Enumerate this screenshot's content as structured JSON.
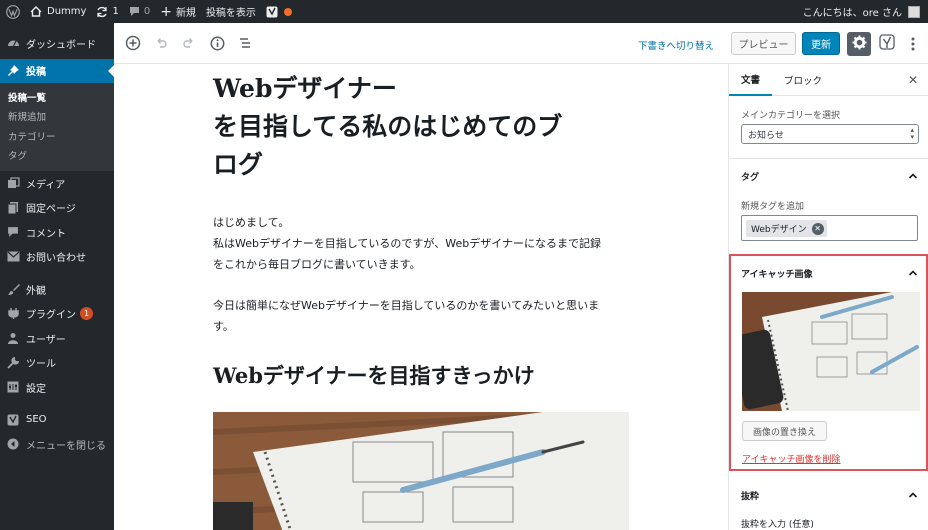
{
  "adminbar": {
    "site_name": "Dummy",
    "updates_count": "1",
    "comments_count": "0",
    "new_label": "新規",
    "view_post_label": "投稿を表示",
    "greeting": "こんにちは、ore さん"
  },
  "sidebar": {
    "items": [
      {
        "label": "ダッシュボード",
        "icon": "dashboard-icon"
      },
      {
        "label": "投稿",
        "icon": "pin-icon"
      },
      {
        "label": "メディア",
        "icon": "media-icon"
      },
      {
        "label": "固定ページ",
        "icon": "pages-icon"
      },
      {
        "label": "コメント",
        "icon": "comment-icon"
      },
      {
        "label": "お問い合わせ",
        "icon": "mail-icon"
      },
      {
        "label": "外観",
        "icon": "brush-icon"
      },
      {
        "label": "プラグイン",
        "icon": "plugin-icon",
        "badge": "1"
      },
      {
        "label": "ユーザー",
        "icon": "user-icon"
      },
      {
        "label": "ツール",
        "icon": "wrench-icon"
      },
      {
        "label": "設定",
        "icon": "settings-icon"
      },
      {
        "label": "SEO",
        "icon": "yoast-icon"
      },
      {
        "label": "メニューを閉じる",
        "icon": "collapse-icon"
      }
    ],
    "submenu": [
      "投稿一覧",
      "新規追加",
      "カテゴリー",
      "タグ"
    ]
  },
  "toolbar": {
    "switch_draft_label": "下書きへ切り替え",
    "preview_label": "プレビュー",
    "update_label": "更新"
  },
  "post": {
    "title_line1": "Webデザイナー",
    "title_line2": "を目指してる私のはじめてのブ",
    "title_line3": "ログ",
    "para1_line1": "はじめまして。",
    "para1_line2": "私はWebデザイナーを目指しているのですが、Webデザイナーになるまで記録",
    "para1_line3": "をこれから毎日ブログに書いていきます。",
    "para2_line1": "今日は簡単になぜWebデザイナーを目指しているのかを書いてみたいと思いま",
    "para2_line2": "す。",
    "heading": "Webデザイナーを目指すきっかけ"
  },
  "panel": {
    "tab_document": "文書",
    "tab_block": "ブロック",
    "main_category_label": "メインカテゴリーを選択",
    "main_category_value": "お知らせ",
    "tags_title": "タグ",
    "add_tag_label": "新規タグを追加",
    "tag_chip": "Webデザイン",
    "featured_title": "アイキャッチ画像",
    "replace_label": "画像の置き換え",
    "remove_label": "アイキャッチ画像を削除",
    "excerpt_title": "抜粋",
    "excerpt_label": "抜粋を入力 (任意)"
  },
  "colors": {
    "admin_dark": "#23282d",
    "accent_blue": "#0073aa",
    "highlight_red": "#d9545d",
    "update_orange": "#f56e28"
  }
}
